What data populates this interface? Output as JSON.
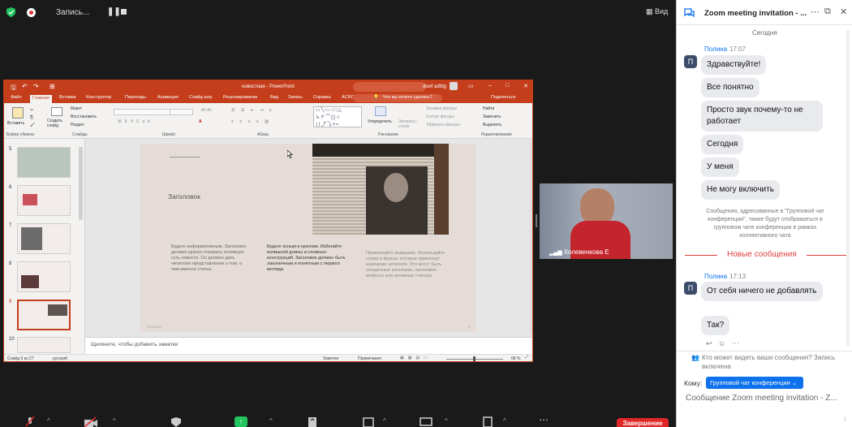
{
  "topbar": {
    "recording_label": "Запись...",
    "view_label": "Вид"
  },
  "ppt": {
    "title": "новостная - PowerPoint",
    "user": "dswf adfdg",
    "tabs": [
      "Файл",
      "Главная",
      "Вставка",
      "Конструктор",
      "Переходы",
      "Анимация",
      "Слайд-шоу",
      "Рецензирование",
      "Вид",
      "Запись",
      "Справка",
      "ACROBAT"
    ],
    "active_tab": "Главная",
    "tell_me": "Что вы хотите сделать?",
    "share": "Поделиться",
    "ribbon": {
      "paste": "Вставить",
      "create_slide": "Создать слайд",
      "layout": "Макет",
      "reset": "Восстановить",
      "section": "Раздел",
      "arrange": "Упорядочить",
      "express_styles": "Экспресс-стили",
      "shape_fill": "Заливка фигуры",
      "shape_outline": "Контур фигуры",
      "shape_effects": "Эффекты фигуры",
      "find": "Найти",
      "replace": "Заменить",
      "select": "Выделить",
      "groups": {
        "clipboard": "Буфер обмена",
        "slides": "Слайды",
        "font": "Шрифт",
        "paragraph": "Абзац",
        "drawing": "Рисование",
        "editing": "Редактирование"
      }
    },
    "thumb_numbers": [
      "5",
      "6",
      "7",
      "8",
      "9",
      "10"
    ],
    "slide": {
      "heading": "Заголовок",
      "col1": "Будьте информативным. Заголовок должен кратко отражать основную суть новости. Он должен дать читателю представление о том, о чем именно статья.",
      "col2": "Будьте ясным и кратким. Избегайте излишней длины и сложных конструкций. Заголовок должен быть лаконичным и понятным с первого взгляда.",
      "col3": "Привлекайте внимание. Используйте слова и фразы, которые привлекут внимание читателя. Это могут быть загадочные заголовки, заголовки-вопросы или активные глаголы",
      "date": "20.05.2023",
      "page_no": "9"
    },
    "notes_placeholder": "Щелкните, чтобы добавить заметки",
    "status": {
      "slide_of": "Слайд 9 из 27",
      "language": "русский",
      "notes": "Заметки",
      "comments": "Примечания",
      "zoom": "68 %"
    }
  },
  "video": {
    "participant": "Холевенкова Е"
  },
  "chat": {
    "title": "Zoom meeting invitation - ...",
    "today": "Сегодня",
    "sender1": "Полина",
    "time1": "17:07",
    "messages1": [
      "Здравствуйте!",
      "Все понятно",
      "Просто звук почему-то не работает",
      "Сегодня",
      "У меня",
      "Не могу включить"
    ],
    "notice": "Сообщения, адресованные в \"Групповой чат конференции\", также будут отображаться в групповом чате конференции в рамках коллективного чата",
    "new_messages": "Новые сообщения",
    "sender2": "Полина",
    "time2": "17:13",
    "messages2": [
      "От себя ничего не добавлять",
      "Так?"
    ],
    "who_can_see": "Кто может видеть ваши сообщения? Запись включена",
    "to_label": "Кому:",
    "recipient": "Групповой чат конференции",
    "input_placeholder": "Сообщение Zoom meeting invitation - Z..."
  },
  "bottombar": {
    "leave_label": "Завершение"
  },
  "colors": {
    "ppt_accent": "#c43e1c",
    "zoom_blue": "#0e72ed",
    "leave_red": "#e02828",
    "new_msg_red": "#e03e3e"
  }
}
